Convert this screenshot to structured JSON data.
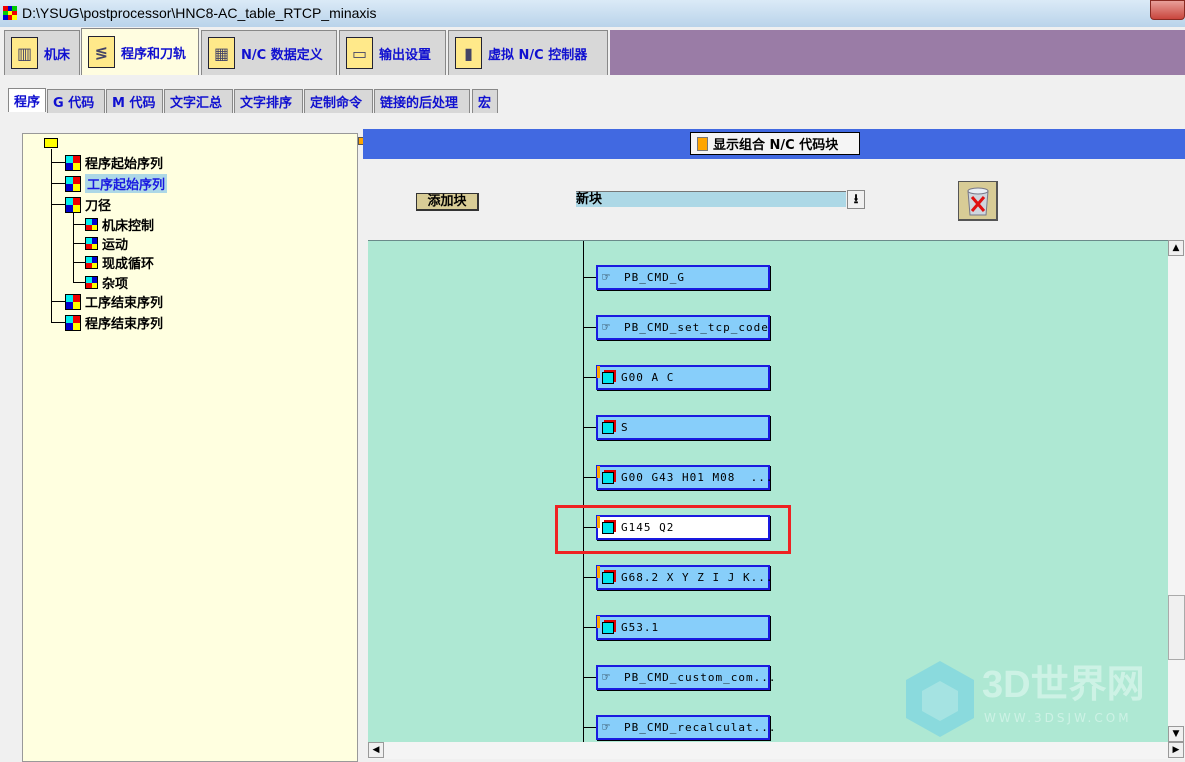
{
  "window": {
    "title": "D:\\YSUG\\postprocessor\\HNC8-AC_table_RTCP_minaxis"
  },
  "main_tabs": [
    {
      "label": "机床",
      "icon": "machine-icon"
    },
    {
      "label": "程序和刀轨",
      "icon": "program-toolpath-icon",
      "active": true
    },
    {
      "label": "N/C 数据定义",
      "icon": "data-definition-icon"
    },
    {
      "label": "输出设置",
      "icon": "printer-icon"
    },
    {
      "label": "虚拟 N/C 控制器",
      "icon": "virtual-controller-icon"
    }
  ],
  "sub_tabs": [
    "程序",
    "G 代码",
    "M 代码",
    "文字汇总",
    "文字排序",
    "定制命令",
    "链接的后处理",
    "宏"
  ],
  "tree": {
    "items": [
      "程序起始序列",
      "工序起始序列",
      "刀径",
      "机床控制",
      "运动",
      "现成循环",
      "杂项",
      "工序结束序列",
      "程序结束序列"
    ],
    "selected": "工序起始序列"
  },
  "panel": {
    "show_combined_label": "显示组合 N/C 代码块",
    "add_block_label": "添加块",
    "block_select_value": "新块",
    "blocks": [
      {
        "text": "PB_CMD_G",
        "type": "command"
      },
      {
        "text": "PB_CMD_set_tcp_code",
        "type": "command"
      },
      {
        "text": "G00 A C",
        "type": "block",
        "flag": true
      },
      {
        "text": "S",
        "type": "block",
        "flag": false
      },
      {
        "text": "G00 G43 H01 M08  ...",
        "type": "block",
        "flag": true
      },
      {
        "text": "G145 Q2",
        "type": "block",
        "flag": true,
        "selected": true
      },
      {
        "text": "G68.2 X Y Z I J K...",
        "type": "block",
        "flag": true
      },
      {
        "text": "G53.1",
        "type": "block",
        "flag": true
      },
      {
        "text": "PB_CMD_custom_com...",
        "type": "command"
      },
      {
        "text": "PB_CMD_recalculat...",
        "type": "command"
      }
    ]
  },
  "watermark": {
    "brand": "3D世界网",
    "url": "WWW.3DSJW.COM"
  }
}
